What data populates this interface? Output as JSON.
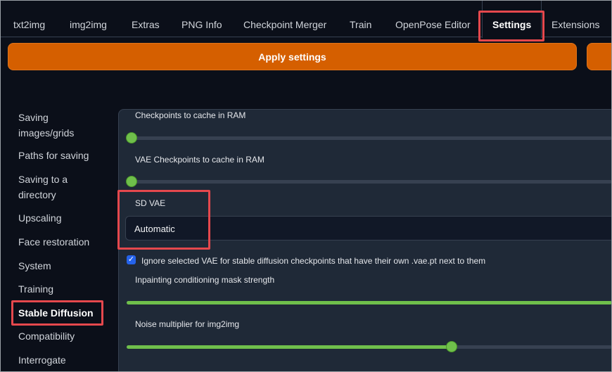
{
  "tabs": [
    {
      "label": "txt2img"
    },
    {
      "label": "img2img"
    },
    {
      "label": "Extras"
    },
    {
      "label": "PNG Info"
    },
    {
      "label": "Checkpoint Merger"
    },
    {
      "label": "Train"
    },
    {
      "label": "OpenPose Editor"
    },
    {
      "label": "Settings"
    },
    {
      "label": "Extensions"
    }
  ],
  "selected_tab": "Settings",
  "apply_button": {
    "label": "Apply settings"
  },
  "sidebar": {
    "items": [
      {
        "label": "Saving\nimages/grids"
      },
      {
        "label": "Paths for saving"
      },
      {
        "label": "Saving to a\ndirectory"
      },
      {
        "label": "Upscaling"
      },
      {
        "label": "Face restoration"
      },
      {
        "label": "System"
      },
      {
        "label": "Training"
      },
      {
        "label": "Stable Diffusion"
      },
      {
        "label": "Compatibility"
      },
      {
        "label": "Interrogate"
      }
    ],
    "active": "Stable Diffusion"
  },
  "settings": {
    "checkpoints_cache": {
      "label": "Checkpoints to cache in RAM",
      "value_fraction": 0.0
    },
    "vae_checkpoints_cache": {
      "label": "VAE Checkpoints to cache in RAM",
      "value_fraction": 0.0
    },
    "sd_vae": {
      "label": "SD VAE",
      "value": "Automatic"
    },
    "ignore_vae": {
      "label": "Ignore selected VAE for stable diffusion checkpoints that have their own .vae.pt next to them",
      "checked": true
    },
    "inpainting_mask_strength": {
      "label": "Inpainting conditioning mask strength",
      "value_fraction": 1.0
    },
    "noise_multiplier": {
      "label": "Noise multiplier for img2img",
      "value_fraction": 0.67
    }
  },
  "colors": {
    "accent_orange": "#d55f00",
    "slider_green": "#6fbf4b",
    "highlight_red": "#e5484d",
    "checkbox_blue": "#2563eb"
  }
}
